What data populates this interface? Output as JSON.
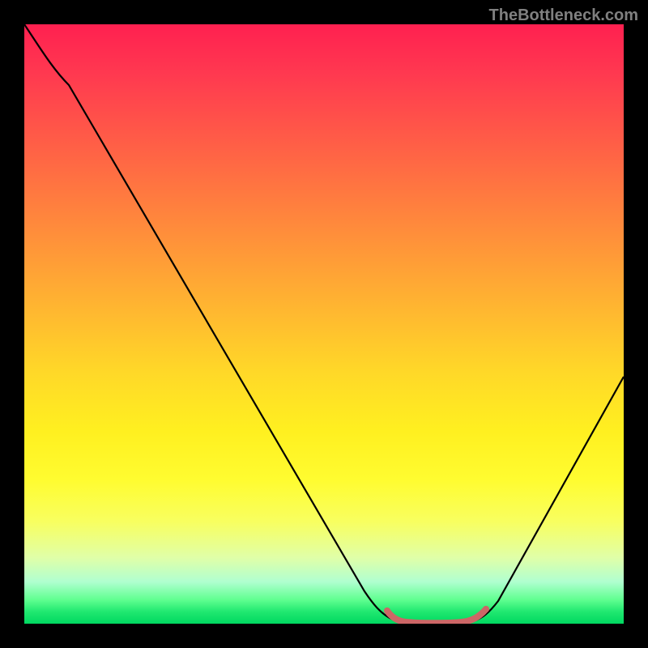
{
  "watermark": "TheBottleneck.com",
  "chart_data": {
    "type": "line",
    "title": "",
    "xlabel": "",
    "ylabel": "",
    "xlim": [
      0,
      100
    ],
    "ylim": [
      0,
      100
    ],
    "series": [
      {
        "name": "bottleneck-curve",
        "x": [
          0,
          5,
          10,
          15,
          20,
          25,
          30,
          35,
          40,
          45,
          50,
          55,
          60,
          62,
          64,
          66,
          68,
          70,
          72,
          74,
          76,
          78,
          80,
          85,
          90,
          95,
          100
        ],
        "y": [
          100,
          96,
          90,
          82.5,
          75,
          67,
          59,
          51,
          43,
          35,
          27,
          19,
          11,
          7,
          4,
          2,
          1,
          0.5,
          0.5,
          1,
          2,
          4,
          7,
          15,
          24,
          33,
          42
        ],
        "color": "#000000"
      },
      {
        "name": "optimal-range-marker",
        "x": [
          62,
          64,
          66,
          68,
          70,
          72,
          74,
          76,
          78
        ],
        "y": [
          4,
          2,
          1,
          0.5,
          0.5,
          0.5,
          1,
          2,
          4
        ],
        "color": "#c86060"
      }
    ],
    "gradient_bands": [
      {
        "y": 100,
        "color": "#ff2050"
      },
      {
        "y": 50,
        "color": "#ffd828"
      },
      {
        "y": 25,
        "color": "#fff020"
      },
      {
        "y": 10,
        "color": "#f8ff60"
      },
      {
        "y": 0,
        "color": "#00d860"
      }
    ]
  }
}
